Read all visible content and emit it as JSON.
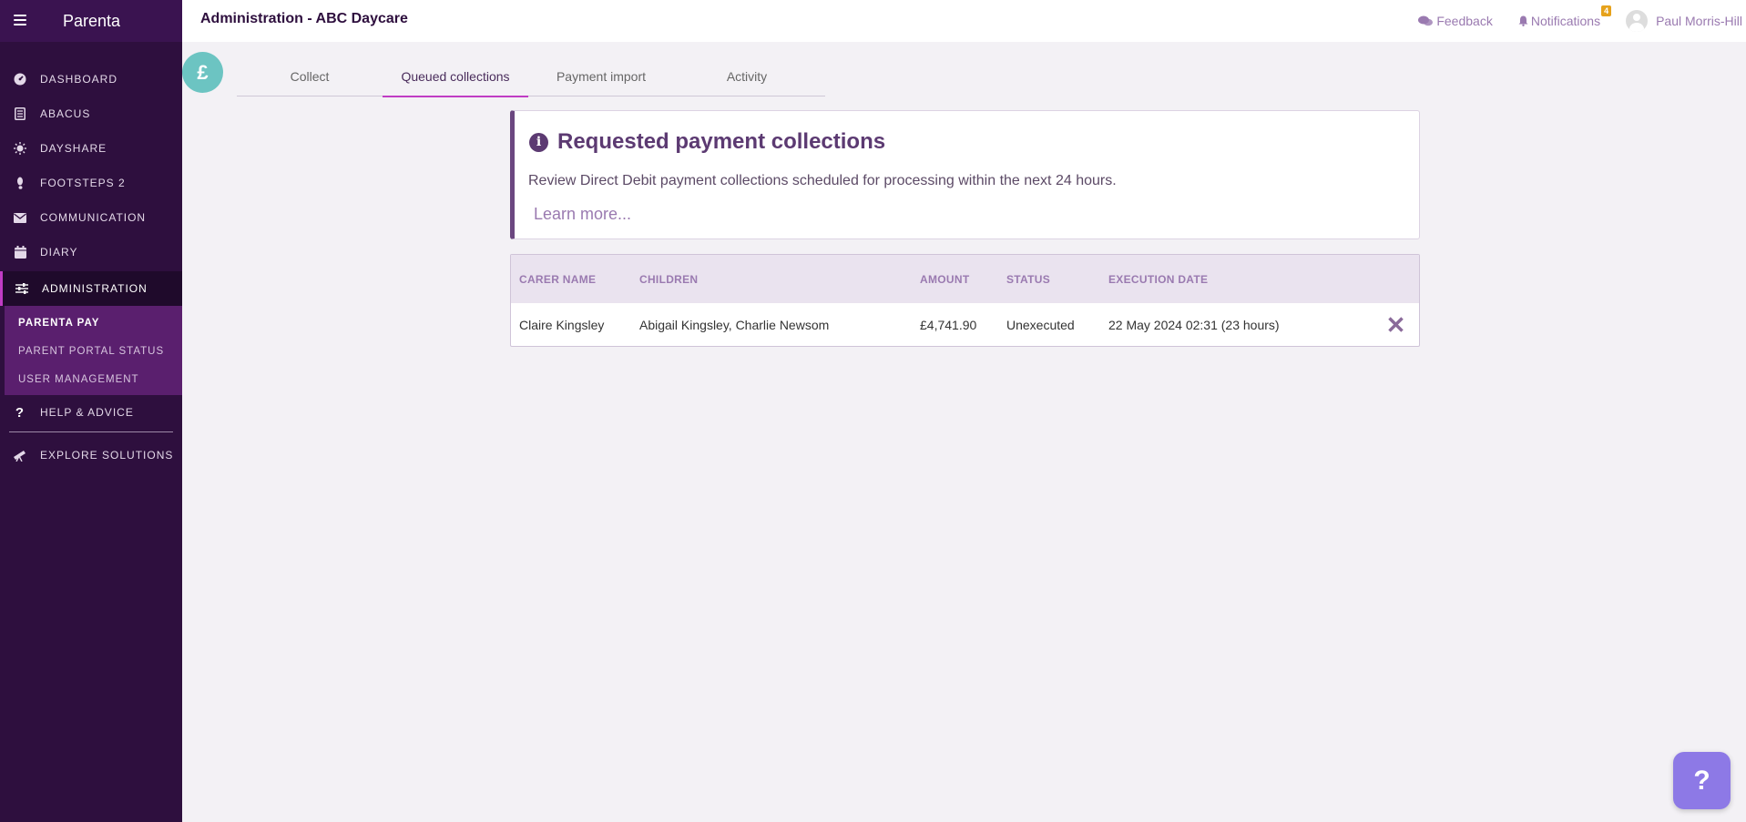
{
  "app": {
    "brand": "Parenta",
    "page_title": "Administration - ABC Daycare"
  },
  "topbar": {
    "feedback_label": "Feedback",
    "notifications_label": "Notifications",
    "notifications_count": "4",
    "user_name": "Paul Morris-Hill"
  },
  "sidebar": {
    "items": [
      {
        "label": "DASHBOARD",
        "icon": "gauge-icon"
      },
      {
        "label": "ABACUS",
        "icon": "abacus-icon"
      },
      {
        "label": "DAYSHARE",
        "icon": "sun-icon"
      },
      {
        "label": "FOOTSTEPS 2",
        "icon": "footprint-icon"
      },
      {
        "label": "COMMUNICATION",
        "icon": "envelope-icon"
      },
      {
        "label": "DIARY",
        "icon": "calendar-icon"
      },
      {
        "label": "ADMINISTRATION",
        "icon": "sliders-icon"
      },
      {
        "label": "HELP & ADVICE",
        "icon": "question-icon"
      },
      {
        "label": "EXPLORE SOLUTIONS",
        "icon": "telescope-icon"
      }
    ],
    "sub_items": [
      {
        "label": "PARENTA PAY"
      },
      {
        "label": "PARENT PORTAL STATUS"
      },
      {
        "label": "USER MANAGEMENT"
      }
    ]
  },
  "section_icon": "£",
  "tabs": [
    {
      "label": "Collect"
    },
    {
      "label": "Queued collections"
    },
    {
      "label": "Payment import"
    },
    {
      "label": "Activity"
    }
  ],
  "info": {
    "title": "Requested payment collections",
    "description": "Review Direct Debit payment collections scheduled for processing within the next 24 hours.",
    "learn_more": "Learn more..."
  },
  "table": {
    "headers": [
      "CARER NAME",
      "CHILDREN",
      "AMOUNT",
      "STATUS",
      "EXECUTION DATE"
    ],
    "rows": [
      {
        "carer": "Claire Kingsley",
        "children": "Abigail Kingsley, Charlie Newsom",
        "amount": "£4,741.90",
        "status": "Unexecuted",
        "execution_date": "22 May 2024 02:31 (23 hours)"
      }
    ]
  },
  "help_button": "?",
  "colors": {
    "sidebar": "#2e0f3e",
    "accent": "#c03cc4",
    "submenu": "#5a1f6e",
    "teal": "#6cc4c2",
    "help": "#8d79e6",
    "badge": "#e6a21b"
  }
}
